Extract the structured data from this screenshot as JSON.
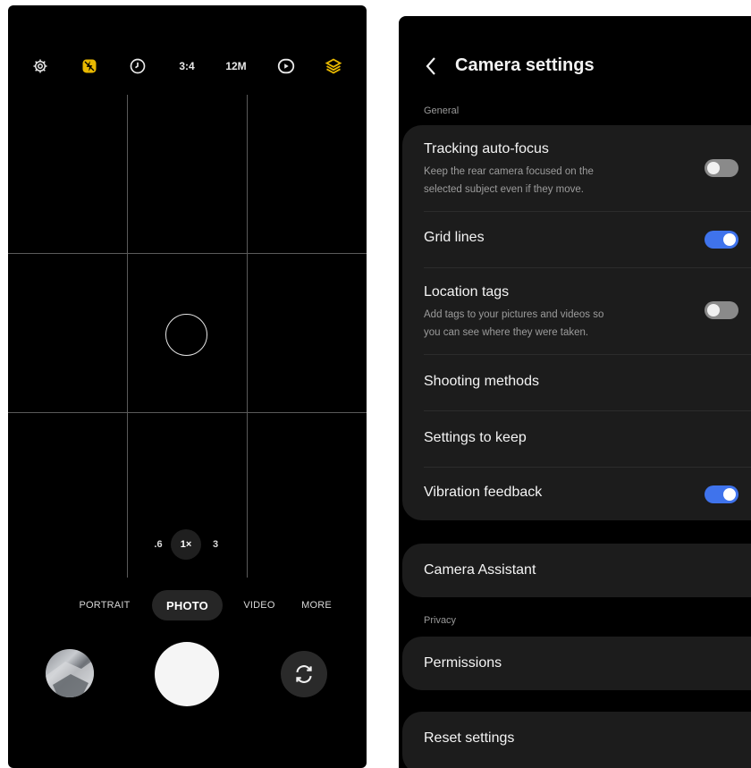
{
  "camera": {
    "topbar": {
      "settings_icon": "gear-icon",
      "flash_icon": "flash-off-icon",
      "timer_icon": "timer-icon",
      "aspect_ratio": "3:4",
      "resolution": "12M",
      "motion_photo_icon": "motion-photo-icon",
      "filters_icon": "filters-icon",
      "accent_color": "#e8b800"
    },
    "zoom": {
      "options": [
        ".6",
        "1×",
        "3"
      ],
      "active": "1×"
    },
    "modes": {
      "items": [
        "PORTRAIT",
        "PHOTO",
        "VIDEO",
        "MORE"
      ],
      "active": "PHOTO"
    },
    "controls": {
      "gallery_icon": "gallery-thumbnail",
      "shutter_icon": "shutter-button",
      "flip_icon": "flip-camera-icon"
    }
  },
  "settings": {
    "title": "Camera settings",
    "back_icon": "back-arrow-icon",
    "toggle_on_color": "#3f73ec",
    "sections": {
      "general": "General",
      "privacy": "Privacy"
    },
    "general_items": {
      "tracking": {
        "title": "Tracking auto-focus",
        "desc1": "Keep the rear camera focused on the",
        "desc2": "selected subject even if they move.",
        "enabled": false
      },
      "grid": {
        "title": "Grid lines",
        "enabled": true
      },
      "location": {
        "title": "Location tags",
        "desc1": "Add tags to your pictures and videos so",
        "desc2": "you can see where they were taken.",
        "enabled": false
      },
      "shooting": {
        "title": "Shooting methods"
      },
      "keep": {
        "title": "Settings to keep"
      },
      "vibration": {
        "title": "Vibration feedback",
        "enabled": true
      }
    },
    "assistant": {
      "title": "Camera Assistant"
    },
    "permissions": {
      "title": "Permissions"
    },
    "reset": {
      "title": "Reset settings"
    }
  }
}
